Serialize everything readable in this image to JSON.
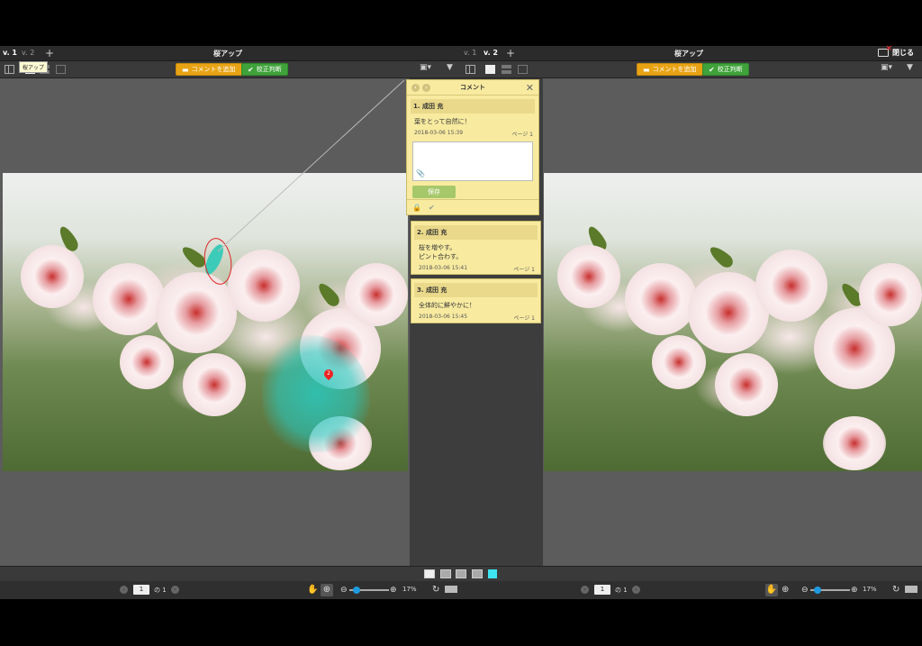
{
  "left": {
    "versions": [
      "v. 1",
      "v. 2"
    ],
    "title": "桜アップ",
    "tooltip": "桜アップ",
    "add_comment_label": "コメントを追加",
    "proof_label": "校正判断",
    "page_value": "1",
    "page_total": "の 1",
    "zoom": "17%"
  },
  "right": {
    "versions": [
      "v. 1",
      "v. 2"
    ],
    "title": "桜アップ",
    "close_label": "閉じる",
    "add_comment_label": "コメントを追加",
    "proof_label": "校正判断",
    "page_value": "1",
    "page_total": "の 1",
    "zoom": "17%"
  },
  "comment_panel": {
    "header": "コメント",
    "save_label": "保存",
    "comments": [
      {
        "title": "1. 成田 充",
        "body": [
          "葉をとって自然に！"
        ],
        "date": "2018-03-06 15:39",
        "page": "ページ 1"
      },
      {
        "title": "2. 成田 充",
        "body": [
          "桜を増やす。",
          "ピント合わす。"
        ],
        "date": "2018-03-06 15:41",
        "page": "ページ 1"
      },
      {
        "title": "3. 成田 充",
        "body": [
          "全体的に鮮やかに！"
        ],
        "date": "2018-03-06 15:45",
        "page": "ページ 1"
      }
    ]
  },
  "annotations": {
    "pin_number": "2"
  },
  "colors": {
    "accent_orange": "#e8a314",
    "accent_green": "#3fa23a",
    "markup_cyan": "#3ccbb8",
    "markup_red": "#d22222"
  }
}
